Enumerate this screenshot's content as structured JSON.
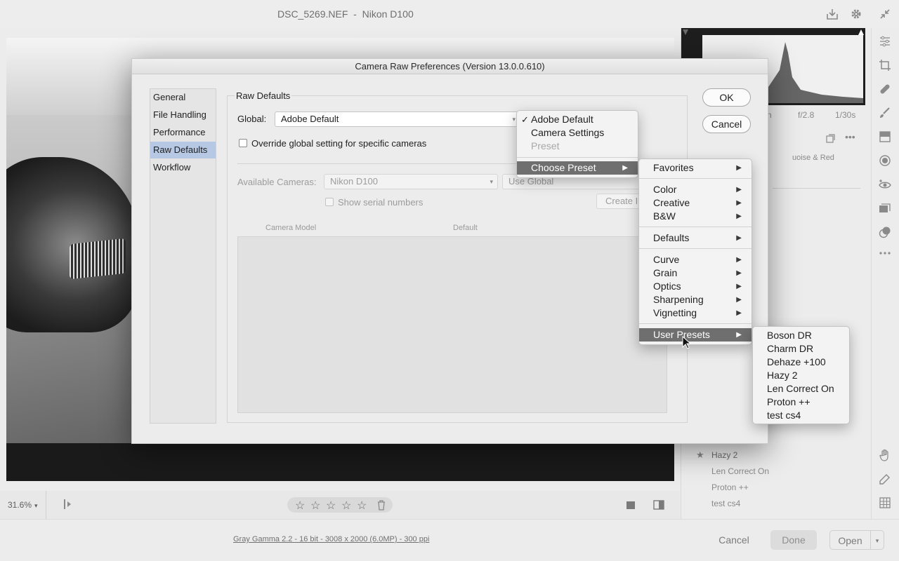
{
  "app": {
    "title": "DSC_5269.NEF  -  Nikon D100",
    "toolbar_icons": [
      "save-icon",
      "gear-icon",
      "collapse-icon"
    ]
  },
  "bottom_toolbar": {
    "zoom": "31.6%",
    "stars": [
      "☆",
      "☆",
      "☆",
      "☆",
      "☆"
    ]
  },
  "status": {
    "workflow_link": "Gray Gamma 2.2 - 16 bit - 3008 x 2000 (6.0MP) - 300 ppi",
    "cancel": "Cancel",
    "done": "Done",
    "open": "Open"
  },
  "right_panel": {
    "readout": [
      "n",
      "f/2.8",
      "1/30s"
    ],
    "list_text": "uoise & Red",
    "presets": [
      "Hazy 2",
      "Len Correct On",
      "Proton ++",
      "test cs4"
    ]
  },
  "dialog": {
    "title": "Camera Raw Preferences  (Version 13.0.0.610)",
    "nav": [
      "General",
      "File Handling",
      "Performance",
      "Raw Defaults",
      "Workflow"
    ],
    "nav_selected": "Raw Defaults",
    "group_label": "Raw Defaults",
    "global_label": "Global:",
    "global_value": "Adobe Default",
    "override_label": "Override global setting for specific cameras",
    "available_label": "Available Cameras:",
    "available_value": "Nikon D100",
    "use_global": "Use Global",
    "serial_label": "Show serial numbers",
    "create_btn": "Create I",
    "col_model": "Camera Model",
    "col_default": "Default",
    "ok": "OK",
    "cancel": "Cancel"
  },
  "menu1": {
    "items": [
      "Adobe Default",
      "Camera Settings",
      "Preset",
      "Choose Preset"
    ],
    "checked": "Adobe Default",
    "disabled": "Preset",
    "highlighted": "Choose Preset"
  },
  "menu2": {
    "items": [
      "Favorites",
      "Color",
      "Creative",
      "B&W",
      "Defaults",
      "Curve",
      "Grain",
      "Optics",
      "Sharpening",
      "Vignetting",
      "User Presets"
    ],
    "highlighted": "User Presets"
  },
  "menu3": {
    "items": [
      "Boson DR",
      "Charm DR",
      "Dehaze +100",
      "Hazy 2",
      "Len Correct On",
      "Proton ++",
      "test cs4"
    ]
  },
  "colors": {
    "menu_highlight": "#6f6f6f",
    "nav_selected": "#b6c8e3"
  }
}
